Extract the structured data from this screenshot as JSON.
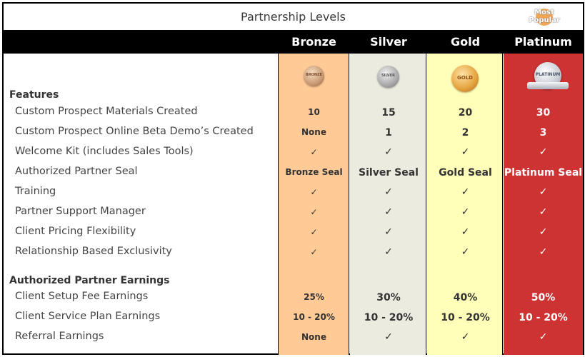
{
  "title": "Partnership Levels",
  "badge": {
    "line1": "Most",
    "line2": "Popular"
  },
  "colors": {
    "header_bg": "#000000",
    "bronze": "#ffca95",
    "silver": "#ecebdf",
    "gold": "#ffffb9",
    "platinum": "#cd3333"
  },
  "tiers": [
    {
      "name": "Bronze",
      "medal_label": "BRONZE"
    },
    {
      "name": "Silver",
      "medal_label": "SILVER"
    },
    {
      "name": "Gold",
      "medal_label": "GOLD"
    },
    {
      "name": "Platinum",
      "medal_label": "PLATINUM"
    }
  ],
  "sections": {
    "features": {
      "title": "Features",
      "rows": [
        {
          "label": "Custom Prospect Materials Created",
          "values": [
            "10",
            "15",
            "20",
            "30"
          ]
        },
        {
          "label": "Custom Prospect Online Beta Demo’s Created",
          "values": [
            "None",
            "1",
            "2",
            "3"
          ]
        },
        {
          "label": "Welcome Kit (includes Sales Tools)",
          "values": [
            "✓",
            "✓",
            "✓",
            "✓"
          ]
        },
        {
          "label": "Authorized Partner Seal",
          "values": [
            "Bronze Seal",
            "Silver Seal",
            "Gold Seal",
            "Platinum Seal"
          ]
        },
        {
          "label": "Training",
          "values": [
            "✓",
            "✓",
            "✓",
            "✓"
          ]
        },
        {
          "label": "Partner Support Manager",
          "values": [
            "✓",
            "✓",
            "✓",
            "✓"
          ]
        },
        {
          "label": "Client Pricing Flexibility",
          "values": [
            "✓",
            "✓",
            "✓",
            "✓"
          ]
        },
        {
          "label": "Relationship Based Exclusivity",
          "values": [
            "✓",
            "✓",
            "✓",
            "✓"
          ]
        }
      ]
    },
    "earnings": {
      "title": "Authorized Partner Earnings",
      "rows": [
        {
          "label": "Client Setup Fee Earnings",
          "values": [
            "25%",
            "30%",
            "40%",
            "50%"
          ]
        },
        {
          "label": "Client Service Plan Earnings",
          "values": [
            "10 - 20%",
            "10 - 20%",
            "10 - 20%",
            "10 - 20%"
          ]
        },
        {
          "label": "Referral Earnings",
          "values": [
            "None",
            "✓",
            "✓",
            "✓"
          ]
        }
      ]
    }
  }
}
